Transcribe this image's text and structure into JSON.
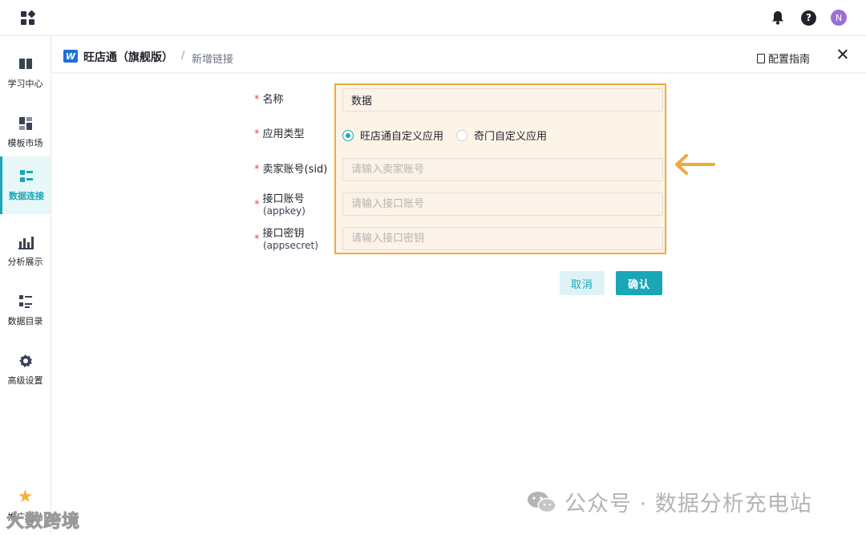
{
  "topbar": {
    "app_menu_icon": "grid-icon",
    "notification_icon": "bell-icon",
    "help_icon": "question-icon",
    "help_glyph": "?",
    "avatar_initial": "N"
  },
  "sidebar": {
    "items": [
      {
        "label": "学习中心",
        "icon": "book-icon",
        "active": false
      },
      {
        "label": "模板市场",
        "icon": "template-icon",
        "active": false
      },
      {
        "label": "数据连接",
        "icon": "data-connect-icon",
        "active": true
      },
      {
        "label": "分析展示",
        "icon": "chart-icon",
        "active": false
      },
      {
        "label": "数据目录",
        "icon": "list-icon",
        "active": false
      },
      {
        "label": "高级设置",
        "icon": "settings-icon",
        "active": false
      }
    ],
    "promo_label": "推广奖励"
  },
  "panel": {
    "brand_logo": "W",
    "title": "旺店通（旗舰版）",
    "separator": "/",
    "breadcrumb": "新增链接",
    "guide_label": "配置指南"
  },
  "form": {
    "required_mark": "*",
    "name": {
      "label": "名称",
      "value": "数据"
    },
    "app_type": {
      "label": "应用类型",
      "options": [
        "旺店通自定义应用",
        "奇门自定义应用"
      ],
      "selected": "旺店通自定义应用"
    },
    "sid": {
      "label": "卖家账号(sid)",
      "placeholder": "请输入卖家账号"
    },
    "appkey": {
      "label": "接口账号",
      "sublabel": "(appkey)",
      "placeholder": "请输入接口账号"
    },
    "appsecret": {
      "label": "接口密钥",
      "sublabel": "(appsecret)",
      "placeholder": "请输入接口密钥"
    },
    "cancel_label": "取消",
    "confirm_label": "确认"
  },
  "colors": {
    "accent": "#1aa6b7",
    "highlight_border": "#f0a93b",
    "highlight_fill": "#fdf4e8",
    "arrow": "#f0a93b"
  },
  "watermark": {
    "right_text": "公众号 · 数据分析充电站",
    "left_text": "大数跨境"
  }
}
